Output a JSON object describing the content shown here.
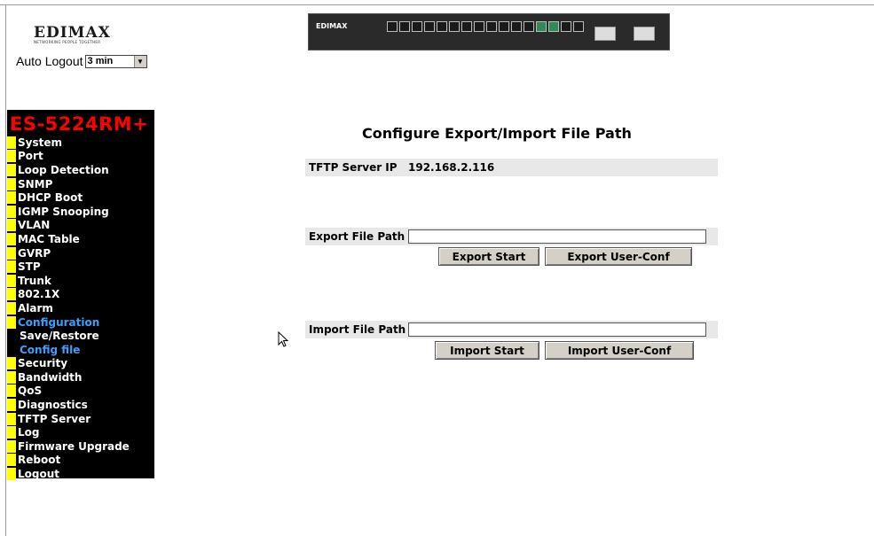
{
  "header": {
    "logo_text": "EDIMAX",
    "logo_tagline": "NETWORKING PEOPLE TOGETHER",
    "auto_logout_label": "Auto Logout",
    "auto_logout_value": "3 min"
  },
  "device": {
    "label": "EDIMAX"
  },
  "sidebar": {
    "model": "ES-5224RM+",
    "items": [
      {
        "label": "System",
        "active": false,
        "sub": false
      },
      {
        "label": "Port",
        "active": false,
        "sub": false
      },
      {
        "label": "Loop Detection",
        "active": false,
        "sub": false
      },
      {
        "label": "SNMP",
        "active": false,
        "sub": false
      },
      {
        "label": "DHCP Boot",
        "active": false,
        "sub": false
      },
      {
        "label": "IGMP Snooping",
        "active": false,
        "sub": false
      },
      {
        "label": "VLAN",
        "active": false,
        "sub": false
      },
      {
        "label": "MAC Table",
        "active": false,
        "sub": false
      },
      {
        "label": "GVRP",
        "active": false,
        "sub": false
      },
      {
        "label": "STP",
        "active": false,
        "sub": false
      },
      {
        "label": "Trunk",
        "active": false,
        "sub": false
      },
      {
        "label": "802.1X",
        "active": false,
        "sub": false
      },
      {
        "label": "Alarm",
        "active": false,
        "sub": false
      },
      {
        "label": "Configuration",
        "active": true,
        "sub": false
      },
      {
        "label": "Save/Restore",
        "active": false,
        "sub": true
      },
      {
        "label": "Config file",
        "active": true,
        "sub": true
      },
      {
        "label": "Security",
        "active": false,
        "sub": false
      },
      {
        "label": "Bandwidth",
        "active": false,
        "sub": false
      },
      {
        "label": "QoS",
        "active": false,
        "sub": false
      },
      {
        "label": "Diagnostics",
        "active": false,
        "sub": false
      },
      {
        "label": "TFTP Server",
        "active": false,
        "sub": false
      },
      {
        "label": "Log",
        "active": false,
        "sub": false
      },
      {
        "label": "Firmware Upgrade",
        "active": false,
        "sub": false
      },
      {
        "label": "Reboot",
        "active": false,
        "sub": false
      },
      {
        "label": "Logout",
        "active": false,
        "sub": false
      }
    ]
  },
  "main": {
    "title": "Configure Export/Import File Path",
    "tftp_label": "TFTP Server IP",
    "tftp_value": "192.168.2.116",
    "export_label": "Export File Path",
    "export_value": "",
    "export_start": "Export Start",
    "export_user_conf": "Export User-Conf",
    "import_label": "Import File Path",
    "import_value": "",
    "import_start": "Import Start",
    "import_user_conf": "Import User-Conf"
  },
  "colors": {
    "sidebar_bg": "#000000",
    "model_color": "#ff0000",
    "bullet": "#ffff00",
    "active_item": "#3aa0ff",
    "row_bg": "#e8e8e8"
  }
}
